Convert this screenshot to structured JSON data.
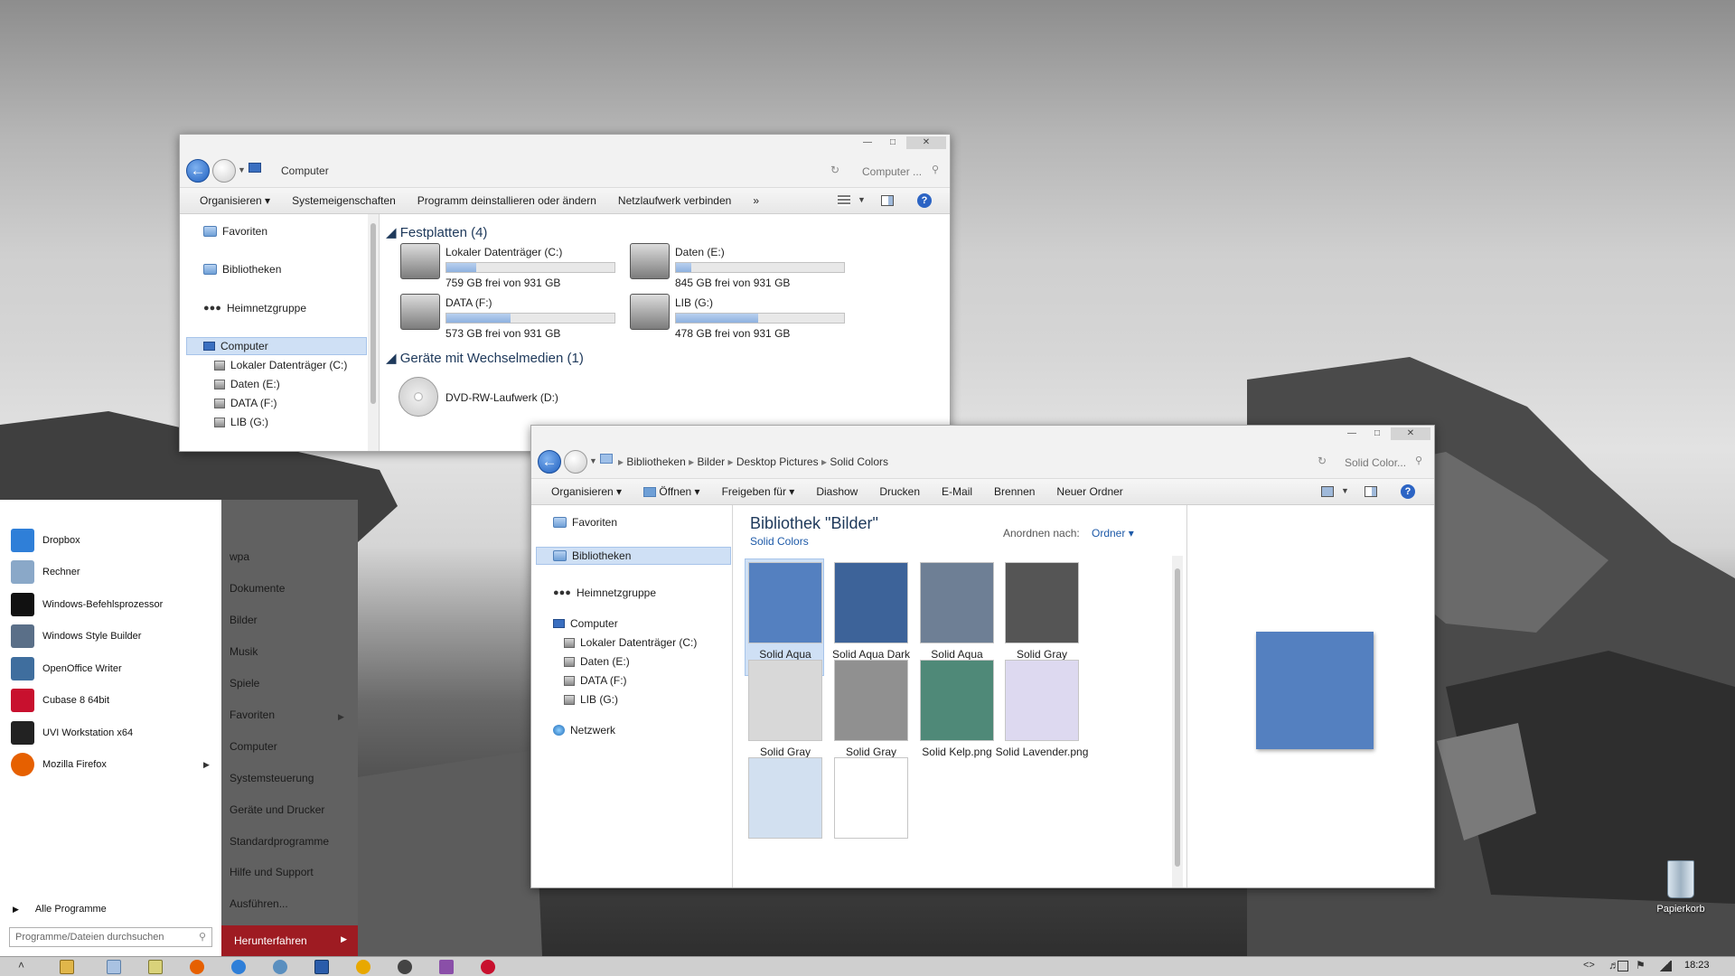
{
  "computer_window": {
    "title": "Computer",
    "search_placeholder": "Computer ...",
    "toolbar": [
      "Organisieren",
      "Systemeigenschaften",
      "Programm deinstallieren oder ändern",
      "Netzlaufwerk verbinden",
      "»"
    ],
    "nav": {
      "favorites": "Favoriten",
      "libraries": "Bibliotheken",
      "homegroup": "Heimnetzgruppe",
      "computer": "Computer",
      "drives": [
        "Lokaler Datenträger (C:)",
        "Daten (E:)",
        "DATA (F:)",
        "LIB (G:)"
      ]
    },
    "hard_disks_header": "Festplatten (4)",
    "drives": [
      {
        "name": "Lokaler Datenträger (C:)",
        "free": "759 GB frei von 931 GB",
        "used_fraction": 0.18
      },
      {
        "name": "Daten (E:)",
        "free": "845 GB frei von 931 GB",
        "used_fraction": 0.09
      },
      {
        "name": "DATA (F:)",
        "free": "573 GB frei von 931 GB",
        "used_fraction": 0.38
      },
      {
        "name": "LIB (G:)",
        "free": "478 GB frei von 931 GB",
        "used_fraction": 0.49
      }
    ],
    "removable_header": "Geräte mit Wechselmedien (1)",
    "removable": [
      {
        "name": "DVD-RW-Laufwerk (D:)"
      }
    ]
  },
  "library_window": {
    "breadcrumb": [
      "Bibliotheken",
      "Bilder",
      "Desktop Pictures",
      "Solid Colors"
    ],
    "search_placeholder": "Solid Color...",
    "toolbar": [
      "Organisieren",
      "Öffnen",
      "Freigeben für",
      "Diashow",
      "Drucken",
      "E-Mail",
      "Brennen",
      "Neuer Ordner"
    ],
    "nav": {
      "favorites": "Favoriten",
      "libraries": "Bibliotheken",
      "homegroup": "Heimnetzgruppe",
      "computer": "Computer",
      "drives": [
        "Lokaler Datenträger (C:)",
        "Daten (E:)",
        "DATA (F:)",
        "LIB (G:)"
      ],
      "network": "Netzwerk"
    },
    "library_title": "Bibliothek \"Bilder\"",
    "library_subtitle": "Solid Colors",
    "arrange_label": "Anordnen nach:",
    "arrange_value": "Ordner",
    "files": [
      {
        "name": "Solid Aqua Blue.png",
        "color": "#5480c0"
      },
      {
        "name": "Solid Aqua Dark Blue.png",
        "color": "#3d6399"
      },
      {
        "name": "Solid Aqua Graphite.png",
        "color": "#6e7f95"
      },
      {
        "name": "Solid Gray Dark.png",
        "color": "#555555"
      },
      {
        "name": "Solid Gray Light.png",
        "color": "#d8d8d8"
      },
      {
        "name": "Solid Gray Medium.png",
        "color": "#909090"
      },
      {
        "name": "Solid Kelp.png",
        "color": "#4f8978"
      },
      {
        "name": "Solid Lavender.png",
        "color": "#ddd9f0"
      },
      {
        "name": "",
        "color": "#d2e0f0"
      },
      {
        "name": "",
        "color": "#ffffff"
      }
    ],
    "preview_color": "#5480c0"
  },
  "start_menu": {
    "programs": [
      {
        "label": "Dropbox",
        "color": "#2f7fd8"
      },
      {
        "label": "Rechner",
        "color": "#8aa8c8"
      },
      {
        "label": "Windows-Befehlsprozessor",
        "color": "#111111"
      },
      {
        "label": "Windows Style Builder",
        "color": "#5a6f88"
      },
      {
        "label": "OpenOffice Writer",
        "color": "#3f6e9e"
      },
      {
        "label": "Cubase 8 64bit",
        "color": "#c8102e"
      },
      {
        "label": "UVI Workstation x64",
        "color": "#222222"
      },
      {
        "label": "Mozilla Firefox",
        "color": "#e66000"
      }
    ],
    "all_programs": "Alle Programme",
    "search_placeholder": "Programme/Dateien durchsuchen",
    "places": [
      "wpa",
      "Dokumente",
      "Bilder",
      "Musik",
      "Spiele",
      "Favoriten",
      "Computer",
      "Systemsteuerung",
      "Geräte und Drucker",
      "Standardprogramme",
      "Hilfe und Support",
      "Ausführen..."
    ],
    "shutdown": "Herunterfahren"
  },
  "desktop": {
    "recycle_bin": "Papierkorb"
  },
  "taskbar": {
    "clock": "18:23"
  }
}
